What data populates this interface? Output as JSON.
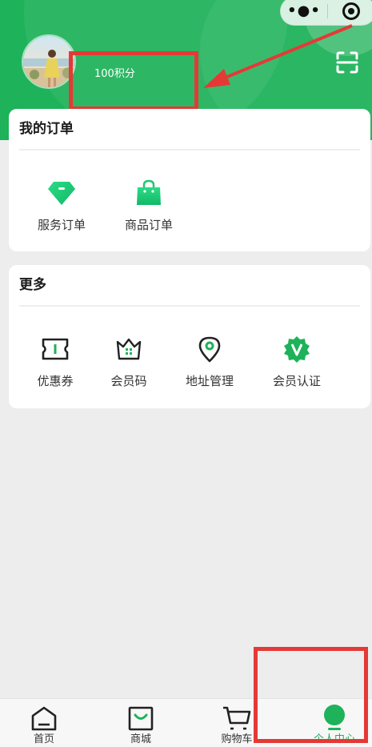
{
  "colors": {
    "brand_green": "#1eb25a",
    "annotation_red": "#e53935",
    "background": "#ededed"
  },
  "header": {
    "points_text": "100积分",
    "capsule": {
      "more_label": "•●•",
      "close_icon": "target-icon"
    },
    "scan_icon": "scan-icon"
  },
  "orders": {
    "title": "我的订单",
    "items": [
      {
        "label": "服务订单",
        "icon": "diamond-icon"
      },
      {
        "label": "商品订单",
        "icon": "shopping-bag-icon"
      }
    ]
  },
  "more": {
    "title": "更多",
    "items": [
      {
        "label": "优惠券",
        "icon": "coupon-icon"
      },
      {
        "label": "会员码",
        "icon": "member-code-icon"
      },
      {
        "label": "地址管理",
        "icon": "location-pin-icon"
      },
      {
        "label": "会员认证",
        "icon": "verified-badge-icon"
      }
    ]
  },
  "tabbar": {
    "active_tab": "个人中心",
    "tabs": [
      {
        "label": "首页",
        "icon": "home-icon"
      },
      {
        "label": "商城",
        "icon": "store-icon"
      },
      {
        "label": "购物车",
        "icon": "cart-icon"
      },
      {
        "label": "个人中心",
        "icon": "profile-icon"
      }
    ]
  }
}
